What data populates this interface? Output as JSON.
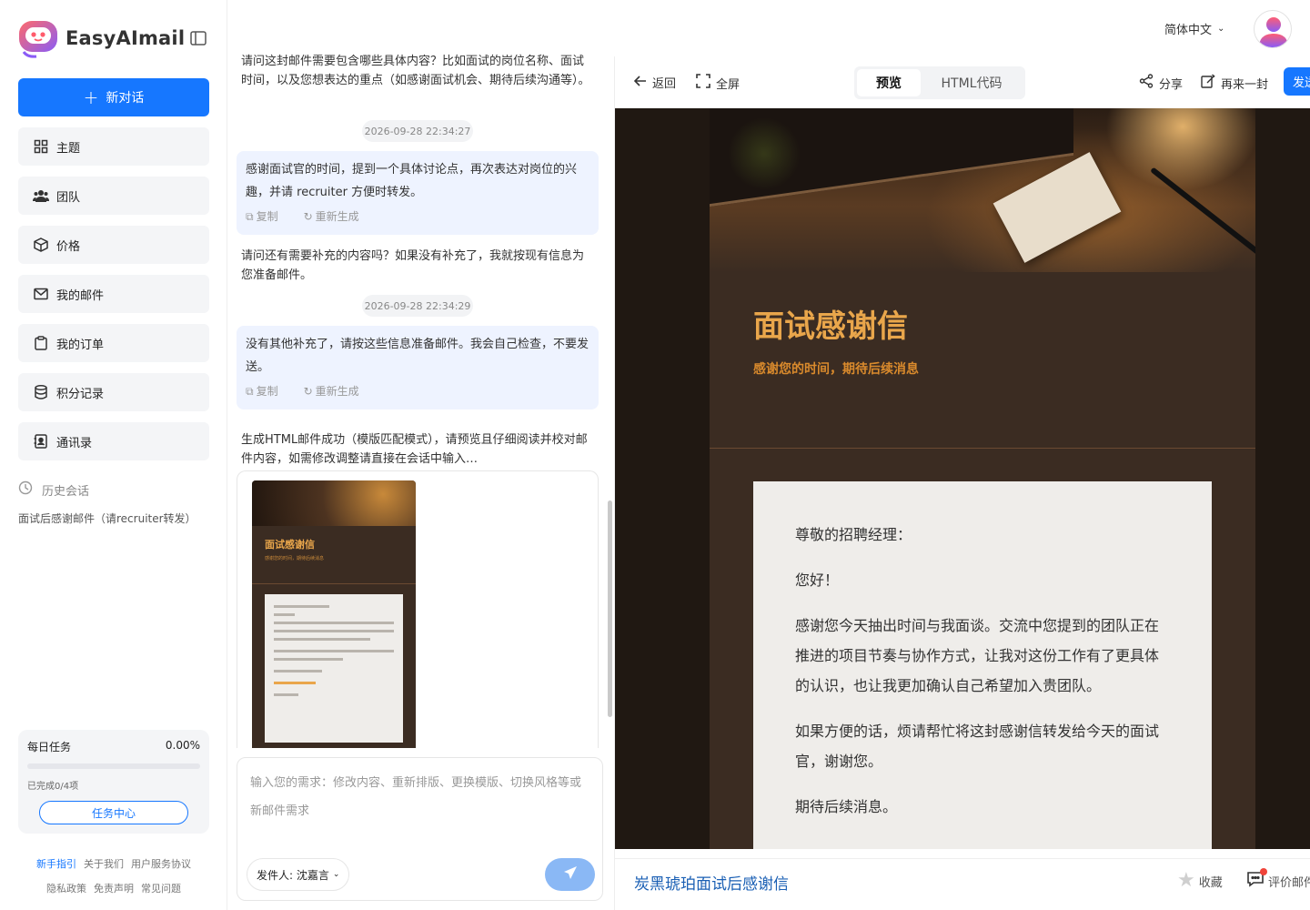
{
  "app": {
    "name": "EasyAImail"
  },
  "sidebar": {
    "new_chat": "新对话",
    "items": [
      {
        "label": "主题",
        "icon": "grid-icon"
      },
      {
        "label": "团队",
        "icon": "users-icon"
      },
      {
        "label": "价格",
        "icon": "box-icon"
      },
      {
        "label": "我的邮件",
        "icon": "mail-icon"
      },
      {
        "label": "我的订单",
        "icon": "clipboard-icon"
      },
      {
        "label": "积分记录",
        "icon": "database-icon"
      },
      {
        "label": "通讯录",
        "icon": "contact-book-icon"
      }
    ],
    "history_title": "历史会话",
    "history": [
      "面试后感谢邮件（请recruiter转发）"
    ],
    "task": {
      "title": "每日任务",
      "percent": "0.00%",
      "progress": 0,
      "done": "已完成0/4项",
      "button": "任务中心"
    },
    "footer": {
      "row1": [
        "新手指引",
        "关于我们",
        "用户服务协议"
      ],
      "row2": [
        "隐私政策",
        "免责声明",
        "常见问题"
      ]
    }
  },
  "header": {
    "language": "简体中文"
  },
  "chat": {
    "messages": [
      "请问这封邮件需要包含哪些具体内容？比如面试的岗位名称、面试时间，以及您想表达的重点（如感谢面试机会、期待后续沟通等）。",
      "请问还有需要补充的内容吗？如果没有补充了，我就按现有信息为您准备邮件。",
      "生成HTML邮件成功（模版匹配模式），请预览且仔细阅读并校对邮件内容，如需修改调整请直接在会话中输入…"
    ],
    "timestamps": [
      "2026-09-28 22:34:27",
      "2026-09-28 22:34:29"
    ],
    "user_messages": [
      "感谢面试官的时间，提到一个具体讨论点，再次表达对岗位的兴趣，并请 recruiter 方便时转发。",
      "没有其他补充了，请按这些信息准备邮件。我会自己检查，不要发送。"
    ],
    "actions": {
      "copy": "复制",
      "regenerate": "重新生成"
    },
    "thumbnail": {
      "title": "面试感谢信",
      "subtitle": "感谢您的时间，期待后续消息"
    },
    "input_placeholder": "输入您的需求：修改内容、重新排版、更换模版、切换风格等或新邮件需求",
    "sender": "发件人: 沈嘉言"
  },
  "preview": {
    "back": "返回",
    "fullscreen": "全屏",
    "tabs": [
      "预览",
      "HTML代码"
    ],
    "share": "分享",
    "again": "再来一封",
    "send": "发送",
    "email": {
      "title": "面试感谢信",
      "subtitle": "感谢您的时间，期待后续消息",
      "greeting": "尊敬的招聘经理：",
      "hello": "您好！",
      "para1": "感谢您今天抽出时间与我面谈。交流中您提到的团队正在推进的项目节奏与协作方式，让我对这份工作有了更具体的认识，也让我更加确认自己希望加入贵团队。",
      "para2": "如果方便的话，烦请帮忙将这封感谢信转发给今天的面试官，谢谢您。",
      "closing": "期待后续消息。"
    },
    "template_name": "炭黑琥珀面试后感谢信",
    "favorite": "收藏",
    "rate": "评价邮件"
  },
  "colors": {
    "primary": "#1677ff",
    "email_bg": "#3b2c22",
    "email_accent": "#e9a64b",
    "bubble_bg": "#eef3ff"
  }
}
